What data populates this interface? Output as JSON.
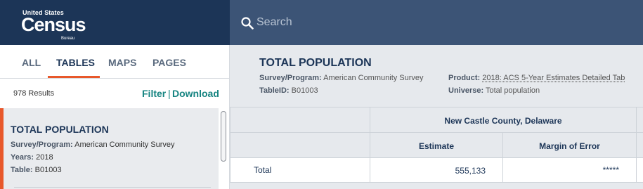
{
  "header": {
    "logo_top": "United States",
    "logo_main": "Census",
    "logo_bottom": "Bureau",
    "search_placeholder": "Search"
  },
  "left": {
    "tabs": [
      {
        "label": "ALL",
        "active": false
      },
      {
        "label": "TABLES",
        "active": true
      },
      {
        "label": "MAPS",
        "active": false
      },
      {
        "label": "PAGES",
        "active": false
      }
    ],
    "results_count": "978 Results",
    "filter_label": "Filter",
    "separator": "|",
    "download_label": "Download",
    "result": {
      "title": "TOTAL POPULATION",
      "survey_label": "Survey/Program:",
      "survey_value": "American Community Survey",
      "years_label": "Years:",
      "years_value": "2018",
      "table_label": "Table:",
      "table_value": "B01003"
    }
  },
  "right": {
    "title": "TOTAL POPULATION",
    "survey_label": "Survey/Program:",
    "survey_value": "American Community Survey",
    "tableid_label": "TableID:",
    "tableid_value": "B01003",
    "product_label": "Product:",
    "product_value": "2018: ACS 5-Year Estimates Detailed Tab",
    "universe_label": "Universe:",
    "universe_value": "Total population",
    "table": {
      "geography": "New Castle County, Delaware",
      "columns": [
        "Estimate",
        "Margin of Error"
      ],
      "rows": [
        {
          "label": "Total",
          "estimate": "555,133",
          "moe": "*****"
        }
      ]
    }
  },
  "colors": {
    "navy": "#1c3557",
    "search_bg": "#3c5476",
    "accent_orange": "#e8582b",
    "link_teal": "#168481"
  }
}
